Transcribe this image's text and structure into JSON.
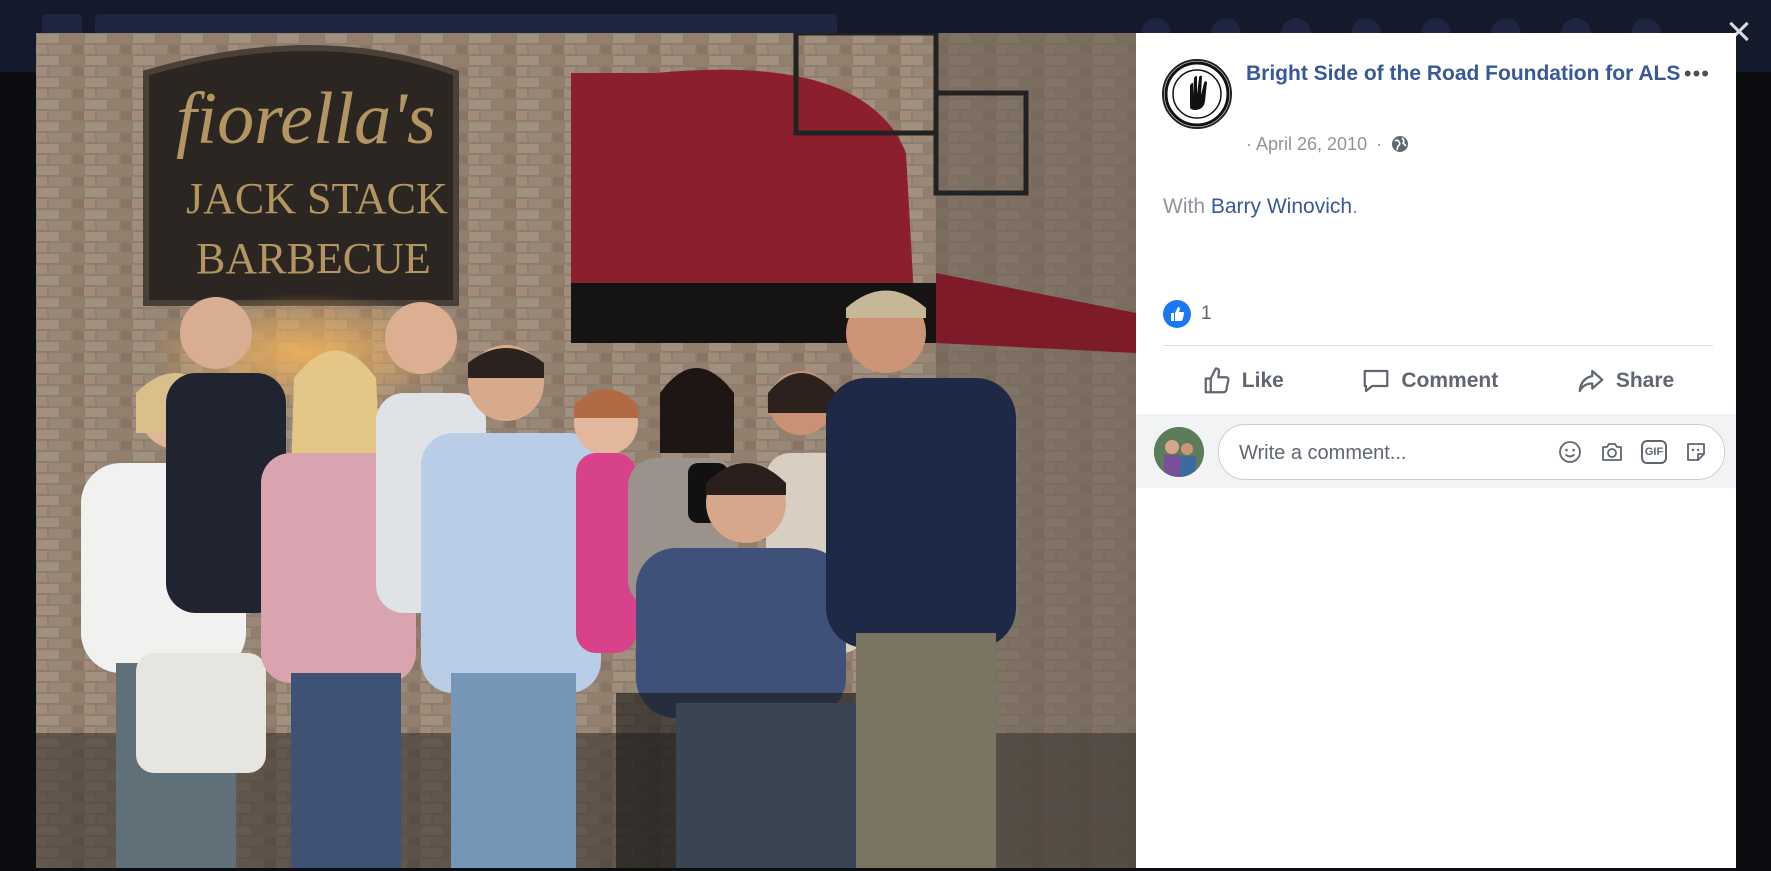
{
  "post": {
    "page_name": "Bright Side of the Road Foundation for ALS",
    "date_prefix": "·",
    "date": "April 26, 2010",
    "date_sep": "·",
    "with_prefix": "With ",
    "tagged_person": "Barry Winovich",
    "with_suffix": ".",
    "like_count": "1",
    "more_label": "•••"
  },
  "actions": {
    "like_label": "Like",
    "comment_label": "Comment",
    "share_label": "Share"
  },
  "comment": {
    "placeholder": "Write a comment...",
    "gif_label": "GIF"
  },
  "photo_sign": {
    "line1": "fiorella's",
    "line2": "JACK STACK",
    "line3": "BARBECUE"
  },
  "close_label": "×",
  "colors": {
    "link": "#385898",
    "like_blue": "#1877f2",
    "muted": "#606770",
    "awning": "#8b1f2e"
  }
}
